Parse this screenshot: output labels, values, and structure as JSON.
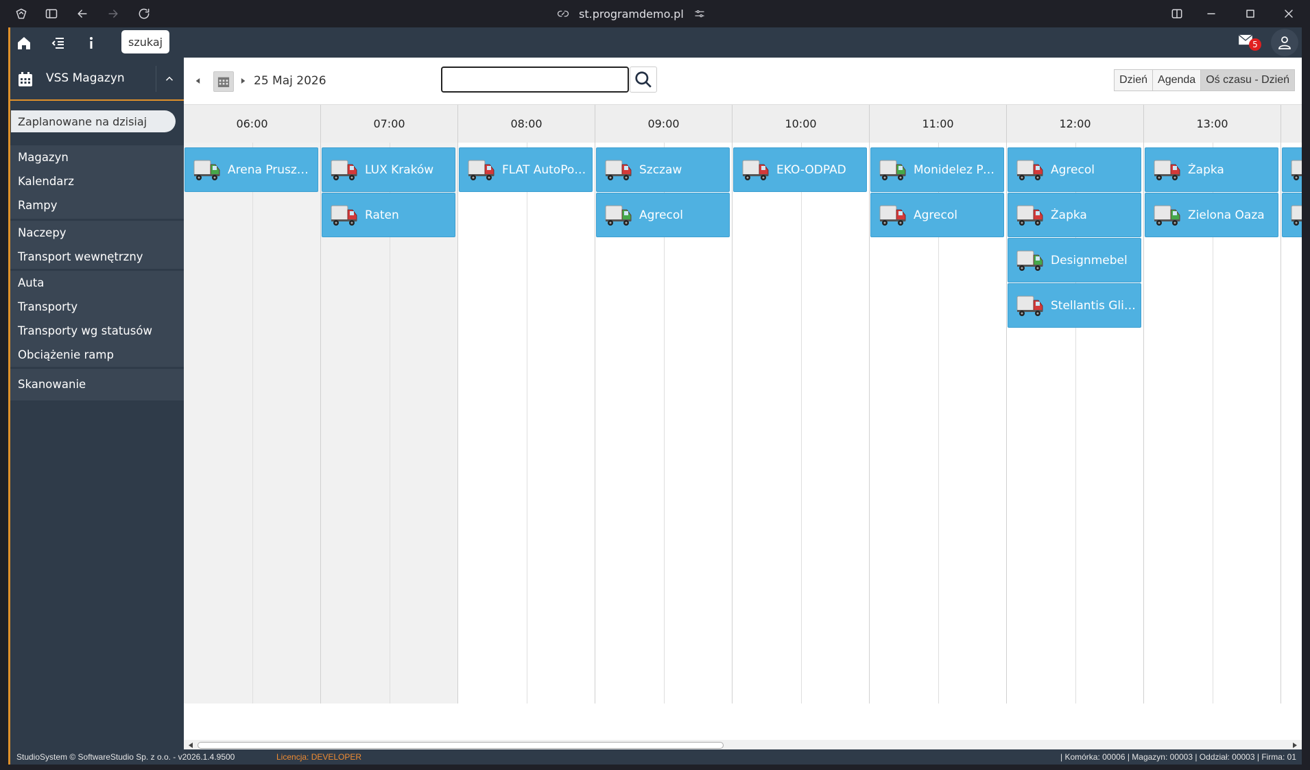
{
  "browser": {
    "url": "st.programdemo.pl"
  },
  "topbar": {
    "search_tooltip": "szukaj",
    "mail_count": "5"
  },
  "sidebar": {
    "title": "VSS Magazyn",
    "today": "Zaplanowane na dzisiaj",
    "groups": [
      [
        "Magazyn",
        "Kalendarz",
        "Rampy"
      ],
      [
        "Naczepy",
        "Transport wewnętrzny"
      ],
      [
        "Auta",
        "Transporty",
        "Transporty wg statusów",
        "Obciążenie ramp"
      ],
      [
        "Skanowanie"
      ]
    ]
  },
  "toolbar": {
    "date": "25 Maj 2026",
    "search_value": "",
    "views": [
      "Dzień",
      "Agenda",
      "Oś czasu - Dzień"
    ],
    "active_view": "Oś czasu - Dzień"
  },
  "timeline": {
    "hours": [
      "06:00",
      "07:00",
      "08:00",
      "09:00",
      "10:00",
      "11:00",
      "12:00",
      "13:00"
    ],
    "events": [
      {
        "hour": "06:00",
        "row": 1,
        "label": "Arena Pruszków",
        "truck": "green"
      },
      {
        "hour": "07:00",
        "row": 1,
        "label": "LUX Kraków",
        "truck": "red"
      },
      {
        "hour": "07:00",
        "row": 2,
        "label": "Raten",
        "truck": "red"
      },
      {
        "hour": "08:00",
        "row": 1,
        "label": "FLAT AutoPolar",
        "truck": "red"
      },
      {
        "hour": "09:00",
        "row": 1,
        "label": "Szczaw",
        "truck": "red"
      },
      {
        "hour": "09:00",
        "row": 2,
        "label": "Agrecol",
        "truck": "green"
      },
      {
        "hour": "10:00",
        "row": 1,
        "label": "EKO-ODPAD",
        "truck": "red"
      },
      {
        "hour": "11:00",
        "row": 1,
        "label": "Monidelez Polska",
        "truck": "green"
      },
      {
        "hour": "11:00",
        "row": 2,
        "label": "Agrecol",
        "truck": "red"
      },
      {
        "hour": "12:00",
        "row": 1,
        "label": "Agrecol",
        "truck": "red"
      },
      {
        "hour": "12:00",
        "row": 2,
        "label": "Żapka",
        "truck": "red"
      },
      {
        "hour": "12:00",
        "row": 3,
        "label": "Designmebel",
        "truck": "green"
      },
      {
        "hour": "12:00",
        "row": 4,
        "label": "Stellantis Gliwice",
        "truck": "red"
      },
      {
        "hour": "13:00",
        "row": 1,
        "label": "Żapka",
        "truck": "red"
      },
      {
        "hour": "13:00",
        "row": 2,
        "label": "Zielona Oaza",
        "truck": "green"
      }
    ]
  },
  "statusbar": {
    "left": "StudioSystem © SoftwareStudio Sp. z o.o. - v2026.1.4.9500",
    "license": "Licencja: DEVELOPER",
    "right": "| Komórka: 00006 | Magazyn: 00003 | Oddział: 00003 | Firma: 01"
  },
  "colors": {
    "accent": "#e0902a",
    "event_bg": "#4fb1e1",
    "sidebar_bg": "#2f3b49",
    "truck_red": "#d33a3a",
    "truck_green": "#46a84a"
  }
}
